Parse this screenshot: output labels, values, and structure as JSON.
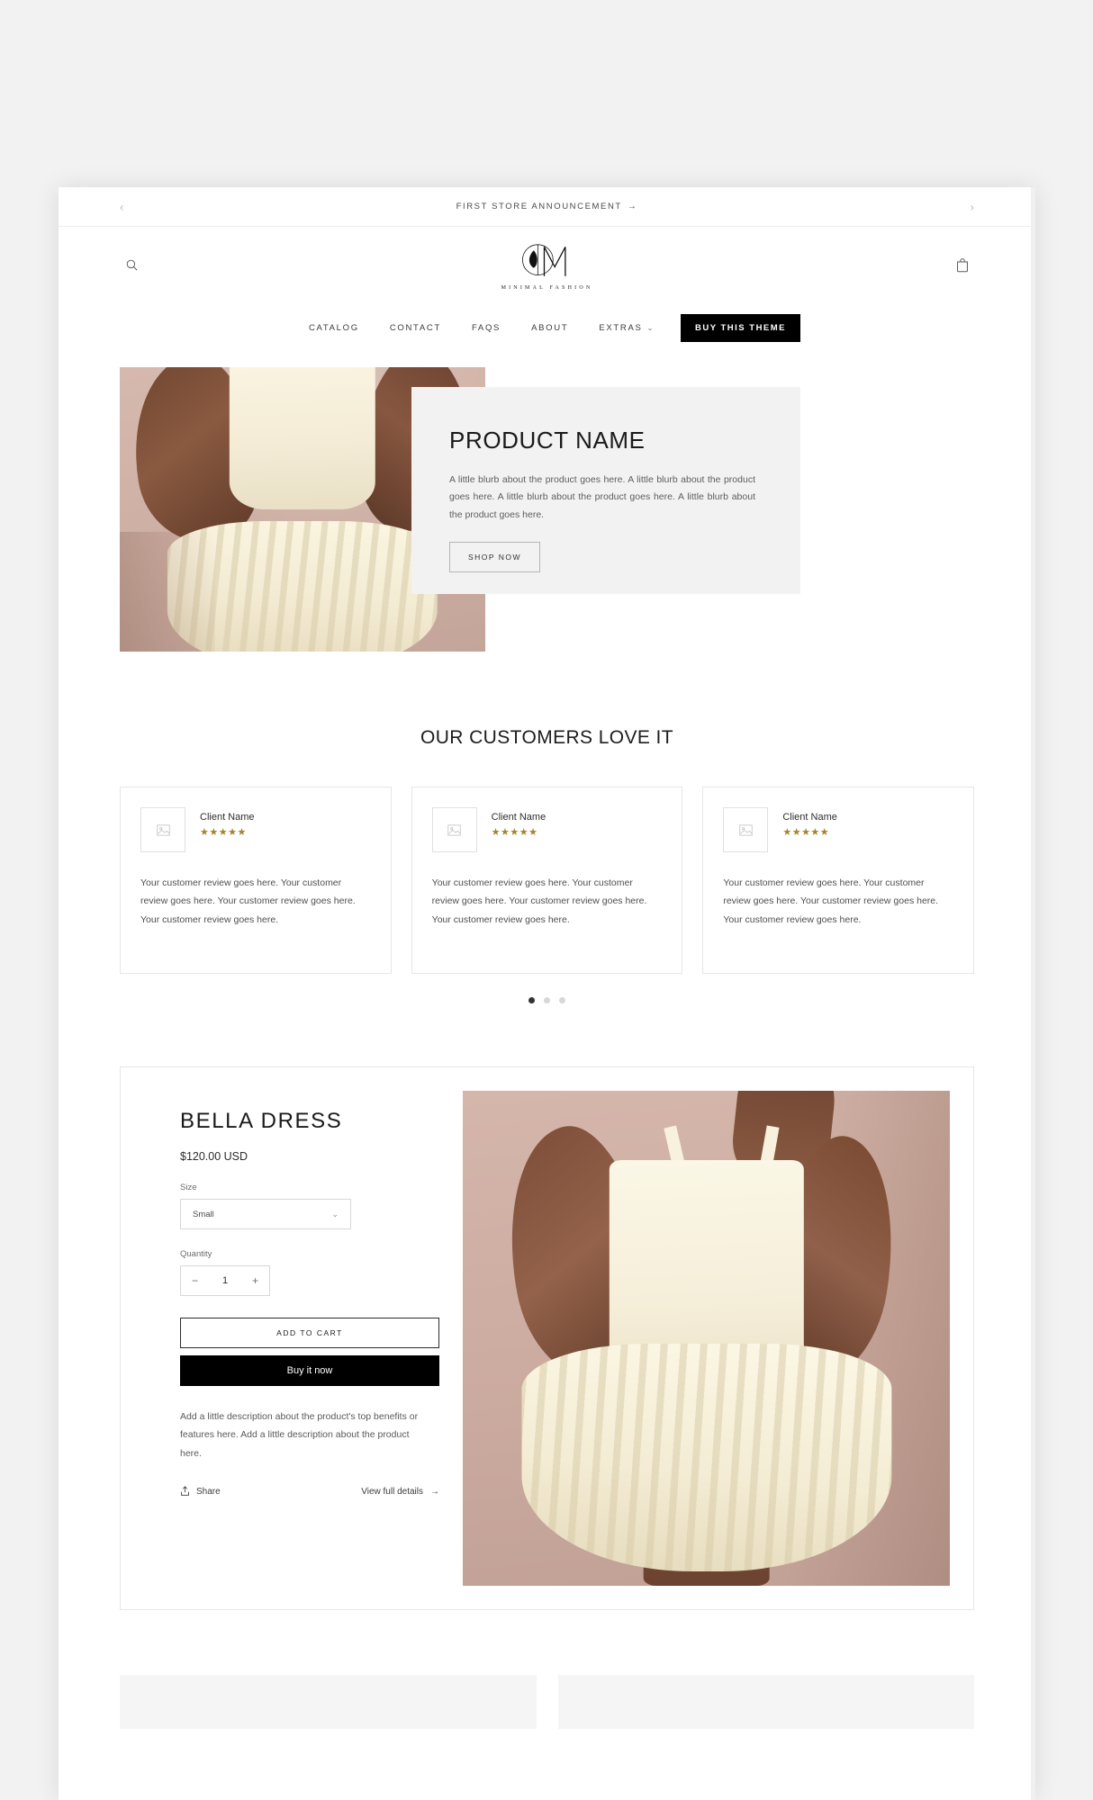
{
  "announcement": {
    "text": "FIRST STORE ANNOUNCEMENT",
    "arrow": "→",
    "prev_icon": "‹",
    "next_icon": "›"
  },
  "header": {
    "search_icon": "search-icon",
    "cart_icon": "cart-icon",
    "logo_letter": "M",
    "logo_subtitle": "MINIMAL FASHION"
  },
  "nav": {
    "items": [
      {
        "label": "CATALOG",
        "active": false
      },
      {
        "label": "CONTACT",
        "active": false
      },
      {
        "label": "FAQS",
        "active": false
      },
      {
        "label": "ABOUT",
        "active": false
      },
      {
        "label": "EXTRAS",
        "active": true
      }
    ],
    "extras_chevron": "⌄",
    "cta_label": "BUY THIS THEME"
  },
  "hero": {
    "title": "PRODUCT NAME",
    "blurb": "A little blurb about the product goes here. A little blurb about the product goes here. A little blurb about the product goes here. A little blurb about the product goes here.",
    "button_label": "SHOP NOW"
  },
  "testimonials": {
    "title": "OUR CUSTOMERS LOVE IT",
    "cards": [
      {
        "name": "Client Name",
        "stars": "★★★★★",
        "review": "Your customer review goes here. Your customer review goes here. Your customer review goes here. Your customer review goes here."
      },
      {
        "name": "Client Name",
        "stars": "★★★★★",
        "review": "Your customer review goes here. Your customer review goes here. Your customer review goes here. Your customer review goes here."
      },
      {
        "name": "Client Name",
        "stars": "★★★★★",
        "review": "Your customer review goes here. Your customer review goes here. Your customer review goes here. Your customer review goes here."
      }
    ],
    "dots": [
      {
        "active": true
      },
      {
        "active": false
      },
      {
        "active": false
      }
    ],
    "star_color": "#a5822a"
  },
  "product": {
    "title": "BELLA DRESS",
    "price": "$120.00 USD",
    "size_label": "Size",
    "size_value": "Small",
    "size_chevron": "⌄",
    "quantity_label": "Quantity",
    "quantity_minus": "−",
    "quantity_value": "1",
    "quantity_plus": "+",
    "add_to_cart_label": "ADD TO CART",
    "buy_now_label": "Buy it now",
    "description": "Add a little description about the product's top benefits or features here. Add a little description about the product here.",
    "share_label": "Share",
    "details_label": "View full details",
    "details_arrow": "→"
  },
  "theme": {
    "accent_black": "#000000",
    "panel_gray": "#f2f2f2",
    "border_gray": "#e6e6e6",
    "page_background": "#f2f2f2"
  }
}
